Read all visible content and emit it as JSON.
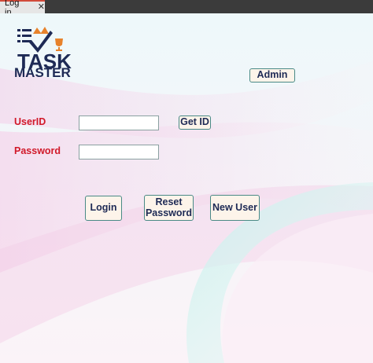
{
  "window": {
    "tab_title": "Log in",
    "close_glyph": "✕"
  },
  "logo": {
    "line1": "TASK",
    "line2": "MASTER",
    "icon": "checklist-crown-logo"
  },
  "buttons": {
    "admin": "Admin",
    "get_id": "Get ID",
    "login": "Login",
    "reset_line1": "Reset",
    "reset_line2": "Password",
    "new_user": "New User"
  },
  "form": {
    "userid_label": "UserID",
    "userid_value": "",
    "password_label": "Password",
    "password_value": ""
  },
  "colors": {
    "label_red": "#d11a2a",
    "button_bg": "#fdf4ea",
    "button_border": "#4a8a86",
    "navy": "#1e2a55",
    "tab_accent": "#d24a3a"
  }
}
